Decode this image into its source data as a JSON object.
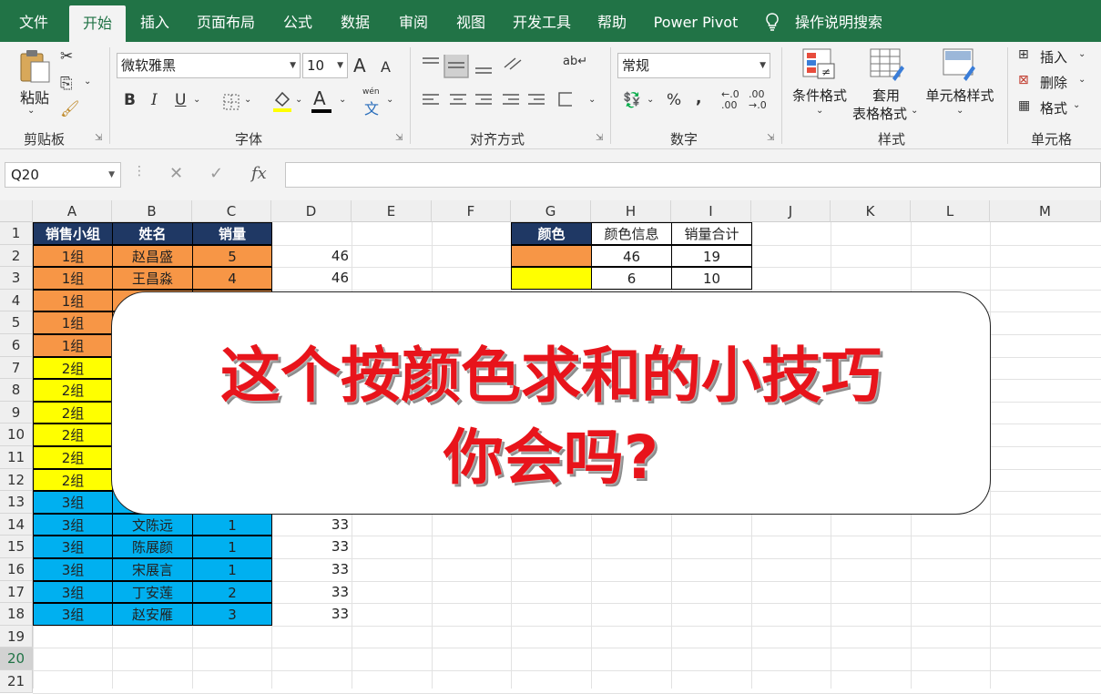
{
  "ribbon": {
    "tabs": [
      "文件",
      "开始",
      "插入",
      "页面布局",
      "公式",
      "数据",
      "审阅",
      "视图",
      "开发工具",
      "帮助",
      "Power Pivot",
      "操作说明搜索"
    ],
    "active_tab": "开始",
    "clipboard": {
      "paste": "粘贴",
      "group": "剪贴板"
    },
    "font": {
      "name": "微软雅黑",
      "size": "10",
      "group": "字体",
      "bold": "B",
      "italic": "I",
      "underline": "U",
      "grow": "A",
      "shrink": "A",
      "color_a": "A",
      "phonetic_top": "wén",
      "phonetic_bottom": "文"
    },
    "alignment": {
      "group": "对齐方式"
    },
    "number": {
      "format": "常规",
      "group": "数字",
      "percent": "%",
      "comma": ","
    },
    "styles": {
      "conditional": "条件格式",
      "table_line1": "套用",
      "table_line2": "表格格式",
      "cell_styles": "单元格样式",
      "group": "样式"
    },
    "cells": {
      "insert": "插入",
      "delete": "删除",
      "format": "格式",
      "group": "单元格"
    }
  },
  "formula_bar": {
    "name_box": "Q20",
    "fx": "fx"
  },
  "colors": {
    "ribbon_green": "#217346",
    "header_blue": "#1f3864",
    "orange": "#f79646",
    "yellow": "#ffff00",
    "blue": "#00b0f0",
    "title_red": "#e8141b"
  },
  "columns": [
    "A",
    "B",
    "C",
    "D",
    "E",
    "F",
    "G",
    "H",
    "I",
    "J",
    "K",
    "L",
    "M"
  ],
  "rows": [
    "1",
    "2",
    "3",
    "4",
    "5",
    "6",
    "7",
    "8",
    "9",
    "10",
    "11",
    "12",
    "13",
    "14",
    "15",
    "16",
    "17",
    "18",
    "19",
    "20",
    "21"
  ],
  "table": {
    "headers": [
      "销售小组",
      "姓名",
      "销量"
    ],
    "rows": [
      {
        "group": "1组",
        "name": "赵昌盛",
        "qty": "5",
        "d": "46",
        "color": "orange"
      },
      {
        "group": "1组",
        "name": "王昌淼",
        "qty": "4",
        "d": "46",
        "color": "orange"
      },
      {
        "group": "1组",
        "name": "",
        "qty": "",
        "d": "",
        "color": "orange"
      },
      {
        "group": "1组",
        "name": "",
        "qty": "",
        "d": "",
        "color": "orange"
      },
      {
        "group": "1组",
        "name": "",
        "qty": "",
        "d": "",
        "color": "orange"
      },
      {
        "group": "2组",
        "name": "",
        "qty": "",
        "d": "",
        "color": "yellow"
      },
      {
        "group": "2组",
        "name": "",
        "qty": "",
        "d": "",
        "color": "yellow"
      },
      {
        "group": "2组",
        "name": "",
        "qty": "",
        "d": "",
        "color": "yellow"
      },
      {
        "group": "2组",
        "name": "",
        "qty": "",
        "d": "",
        "color": "yellow"
      },
      {
        "group": "2组",
        "name": "",
        "qty": "",
        "d": "",
        "color": "yellow"
      },
      {
        "group": "2组",
        "name": "",
        "qty": "",
        "d": "",
        "color": "yellow"
      },
      {
        "group": "3组",
        "name": "",
        "qty": "",
        "d": "",
        "color": "blue"
      },
      {
        "group": "3组",
        "name": "文陈远",
        "qty": "1",
        "d": "33",
        "color": "blue"
      },
      {
        "group": "3组",
        "name": "陈展颜",
        "qty": "1",
        "d": "33",
        "color": "blue"
      },
      {
        "group": "3组",
        "name": "宋展言",
        "qty": "1",
        "d": "33",
        "color": "blue"
      },
      {
        "group": "3组",
        "name": "丁安莲",
        "qty": "2",
        "d": "33",
        "color": "blue"
      },
      {
        "group": "3组",
        "name": "赵安雁",
        "qty": "3",
        "d": "33",
        "color": "blue"
      }
    ]
  },
  "summary": {
    "headers": [
      "颜色",
      "颜色信息",
      "销量合计"
    ],
    "rows": [
      {
        "color": "orange",
        "info": "46",
        "total": "19"
      },
      {
        "color": "yellow",
        "info": "6",
        "total": "10"
      }
    ]
  },
  "overlay": {
    "line1": "这个按颜色求和的小技巧",
    "line2": "你会吗?"
  }
}
